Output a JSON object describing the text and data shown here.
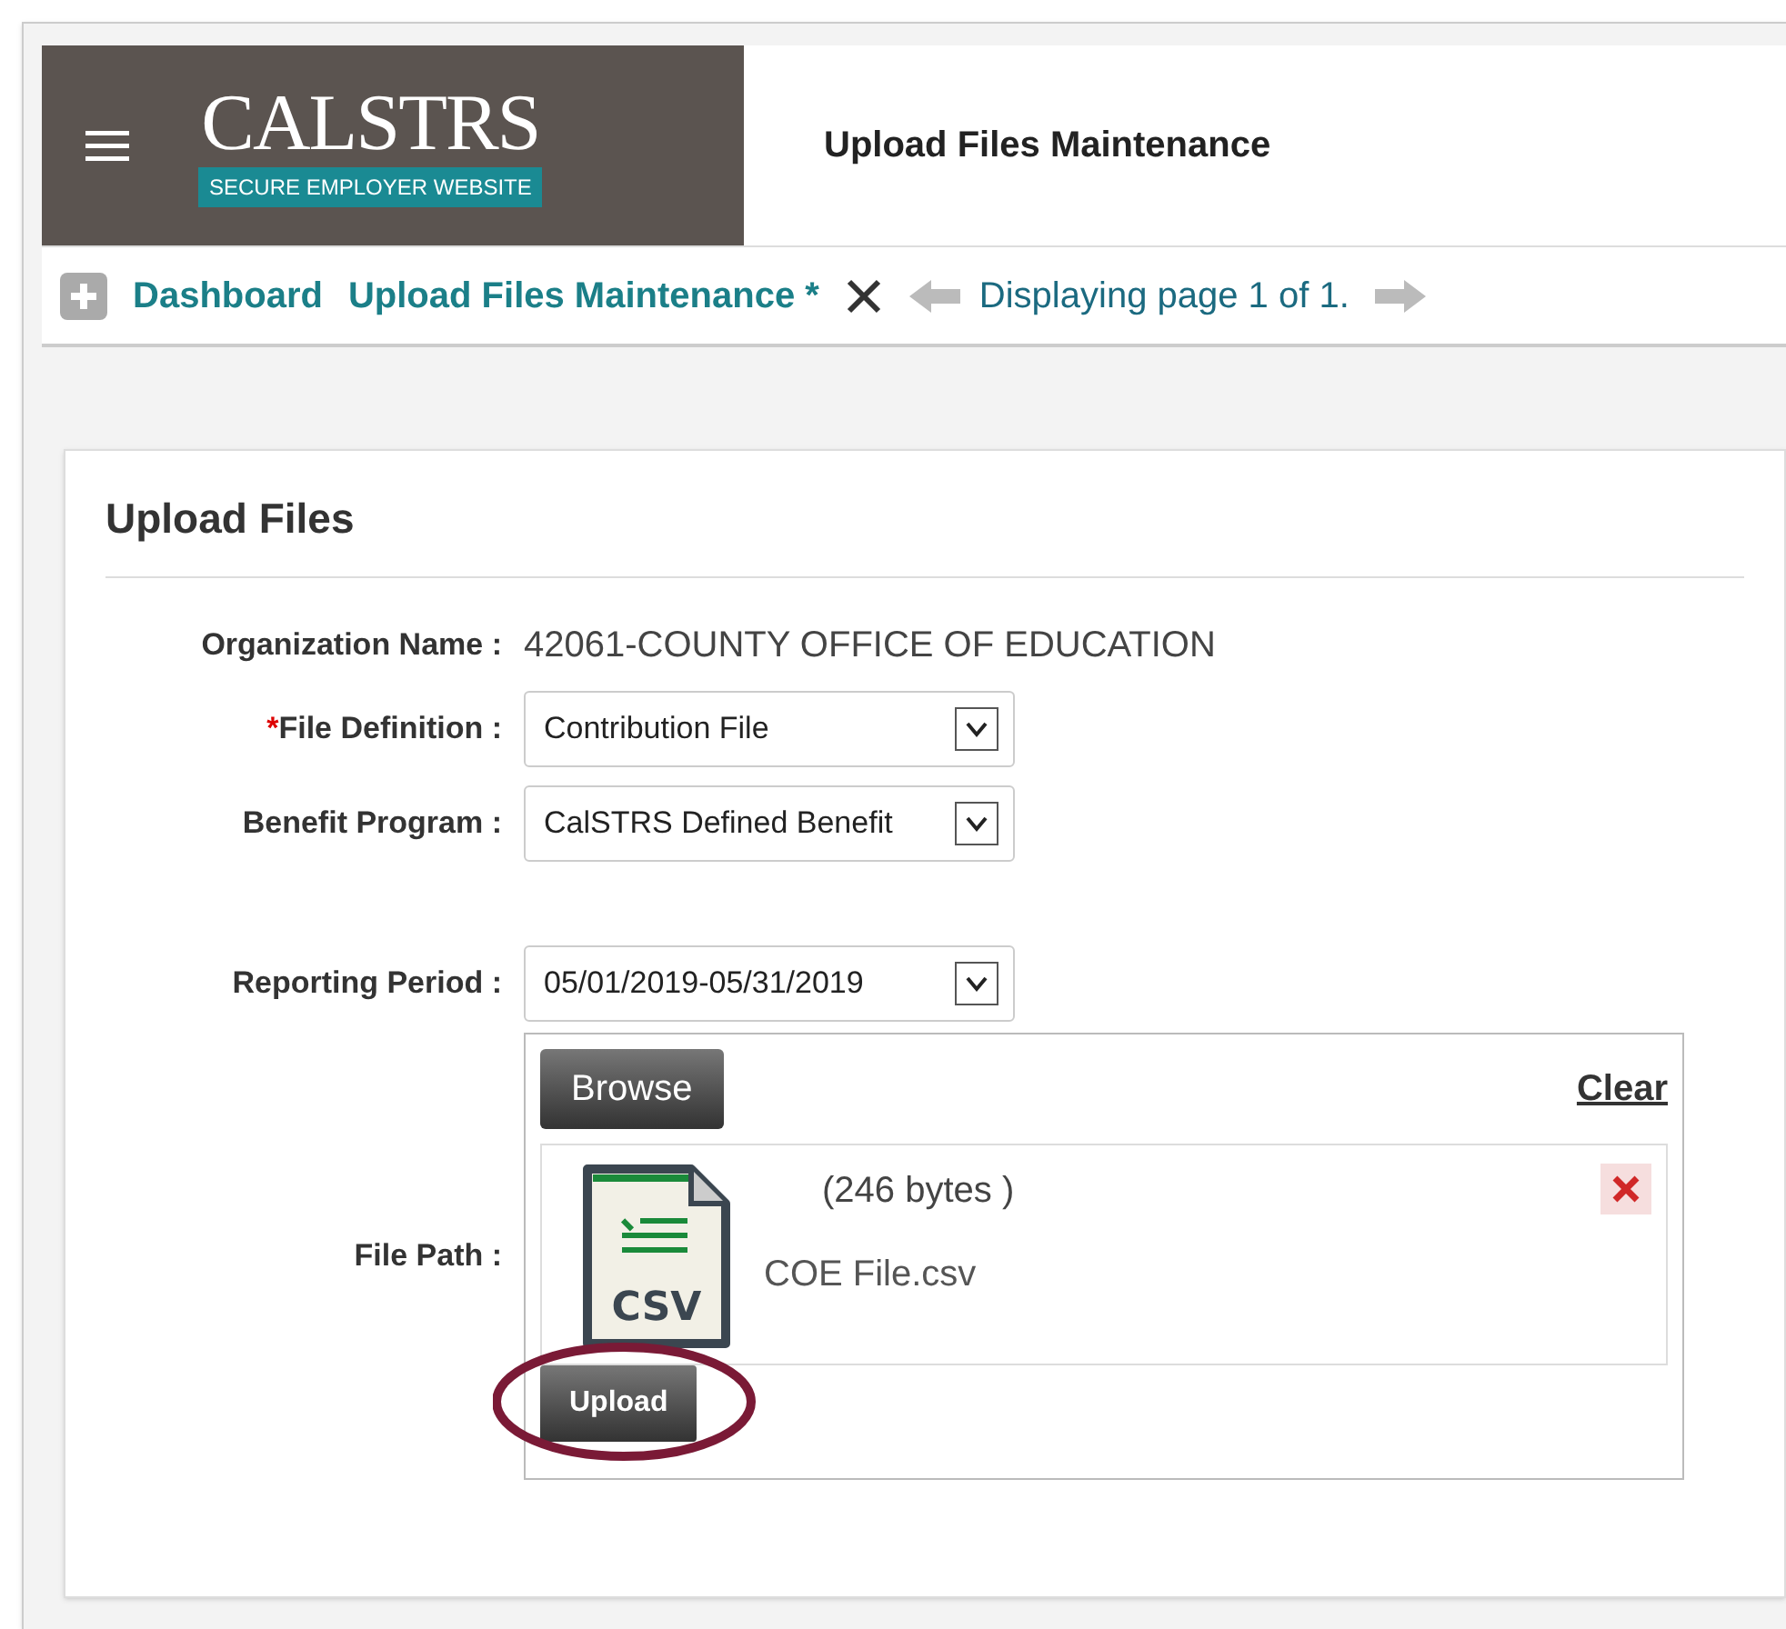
{
  "header": {
    "logo": {
      "name": "CALSTRS",
      "tagline": "SECURE EMPLOYER WEBSITE"
    },
    "title": "Upload Files Maintenance"
  },
  "tabs": [
    {
      "label": "Dashboard",
      "closable": false
    },
    {
      "label": "Upload Files Maintenance *",
      "closable": true
    }
  ],
  "pager": {
    "text": "Displaying page 1 of 1."
  },
  "panel": {
    "title": "Upload Files",
    "fields": [
      {
        "kind": "text",
        "label": "Organization Name :",
        "required": false,
        "value": "42061-COUNTY OFFICE OF EDUCATION"
      },
      {
        "kind": "select",
        "label": "File Definition :",
        "required": true,
        "value": "Contribution File"
      },
      {
        "kind": "select",
        "label": "Benefit Program :",
        "required": false,
        "value": "CalSTRS Defined Benefit"
      },
      {
        "kind": "select",
        "label": "Reporting Period :",
        "required": false,
        "value": "05/01/2019-05/31/2019"
      }
    ],
    "required_mark": "*",
    "file_path": {
      "label": "File Path :",
      "browse": "Browse",
      "clear": "Clear",
      "file": {
        "icon_label": "CSV",
        "size": "(246 bytes )",
        "name": "COE File.csv"
      },
      "upload": "Upload",
      "upload_highlighted": true
    }
  }
}
